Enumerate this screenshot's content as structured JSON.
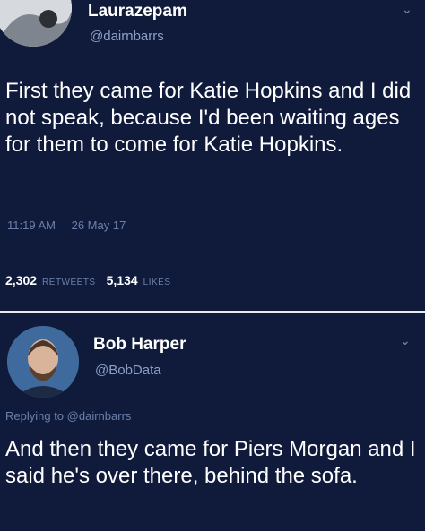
{
  "tweet1": {
    "name": "Laurazepam",
    "handle": "@dairnbarrs",
    "text": "First they came for Katie Hopkins and I did not speak, because I'd been waiting ages for them to come for Katie Hopkins.",
    "time": "11:19 AM",
    "date": "26 May 17",
    "retweets_count": "2,302",
    "retweets_label": "RETWEETS",
    "likes_count": "5,134",
    "likes_label": "LIKES"
  },
  "tweet2": {
    "name": "Bob Harper",
    "handle": "@BobData",
    "replying_prefix": "Replying to",
    "replying_handle": "@dairnbarrs",
    "text": "And then they came for Piers Morgan and I said he's over there, behind the sofa."
  },
  "icons": {
    "chevron": "chevron-down-icon",
    "avatar": "avatar"
  }
}
